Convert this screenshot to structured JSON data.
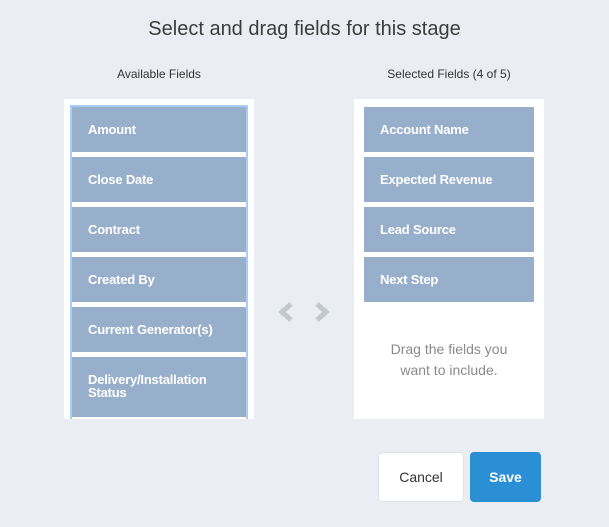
{
  "dialog": {
    "title": "Select and drag fields for this stage"
  },
  "available": {
    "label": "Available Fields",
    "items": [
      "Amount",
      "Close Date",
      "Contract",
      "Created By",
      "Current Generator(s)",
      "Delivery/Installation Status"
    ]
  },
  "selected": {
    "label": "Selected Fields (4 of 5)",
    "items": [
      "Account Name",
      "Expected Revenue",
      "Lead Source",
      "Next Step"
    ],
    "hint_line1": "Drag the fields you",
    "hint_line2": "want to include."
  },
  "buttons": {
    "cancel": "Cancel",
    "save": "Save"
  },
  "colors": {
    "accent": "#2b8fd6",
    "field_bg": "#97afcb",
    "focus_border": "#a9cdf5"
  }
}
